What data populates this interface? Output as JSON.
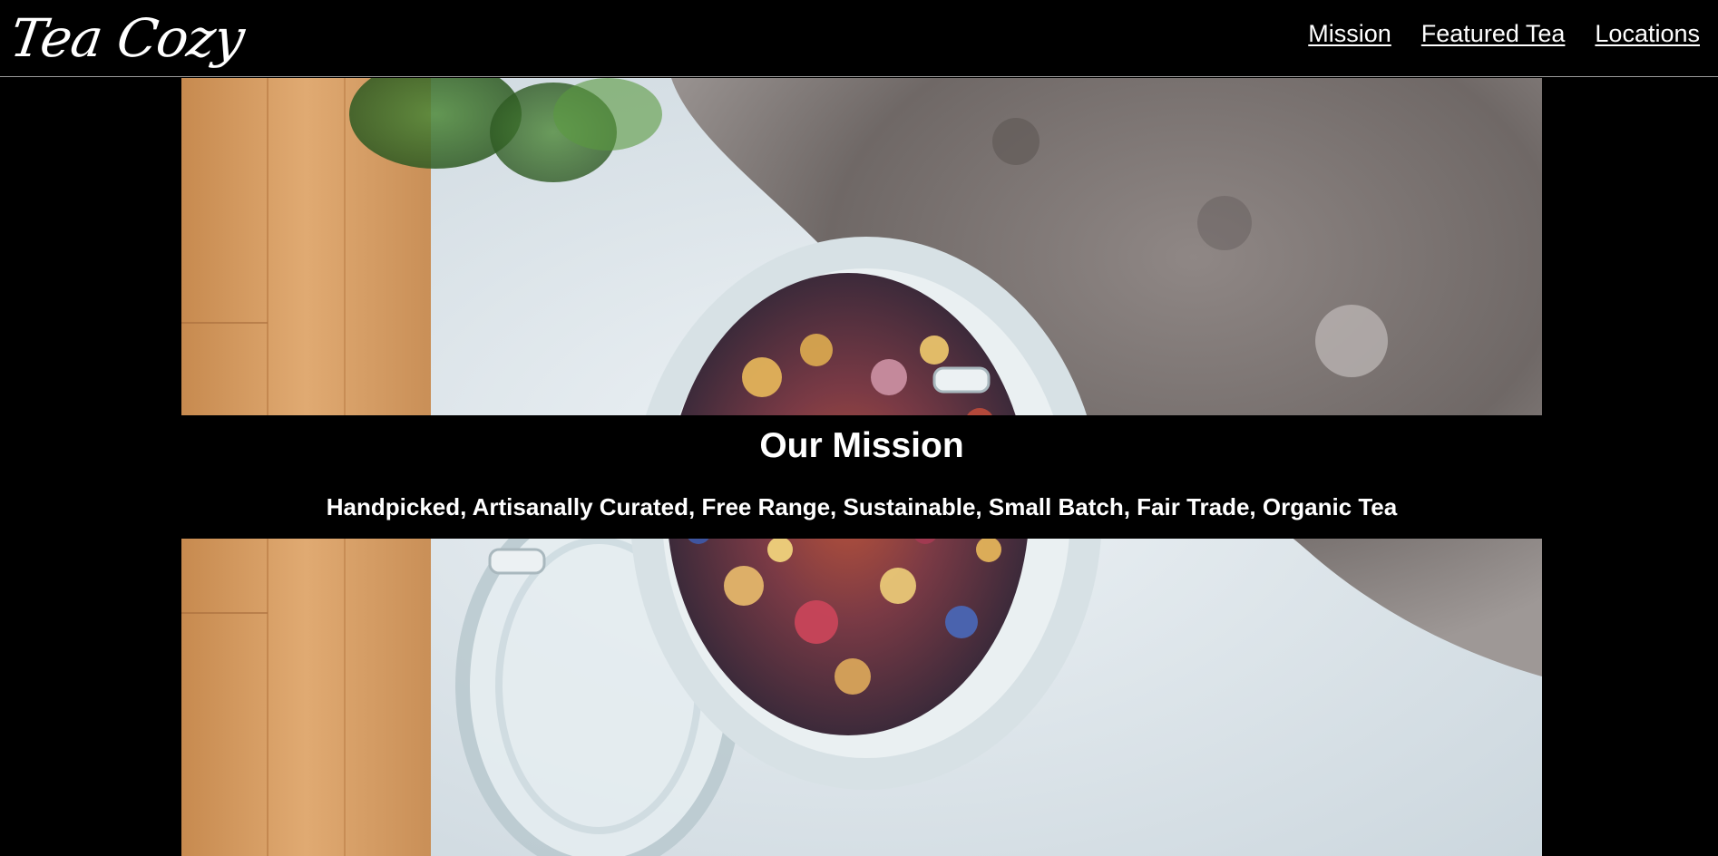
{
  "header": {
    "logo_text": "Tea Cozy",
    "nav": [
      {
        "label": "Mission"
      },
      {
        "label": "Featured Tea"
      },
      {
        "label": "Locations"
      }
    ]
  },
  "mission": {
    "title": "Our Mission",
    "subtitle": "Handpicked, Artisanally Curated, Free Range, Sustainable, Small Batch, Fair Trade, Organic Tea"
  },
  "colors": {
    "background": "#000000",
    "text": "#ffffff",
    "header_border": "#9a9a9a"
  },
  "icons": {
    "hero": "loose-leaf-tea-jar-photo"
  }
}
